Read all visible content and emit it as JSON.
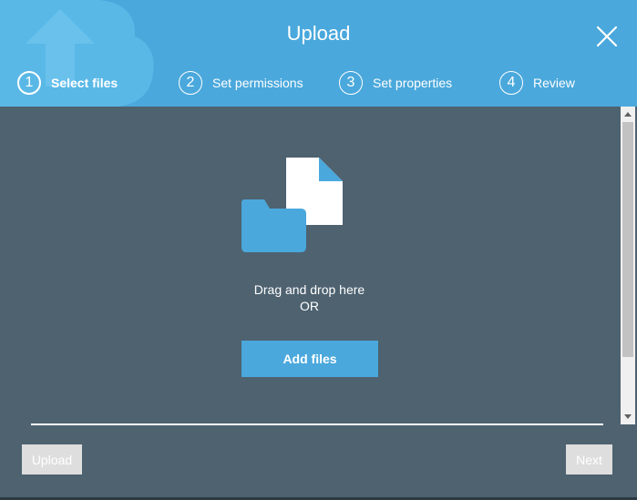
{
  "dialog": {
    "title": "Upload",
    "close_icon": "close-icon"
  },
  "steps": [
    {
      "number": "1",
      "label": "Select files",
      "active": true
    },
    {
      "number": "2",
      "label": "Set permissions",
      "active": false
    },
    {
      "number": "3",
      "label": "Set properties",
      "active": false
    },
    {
      "number": "4",
      "label": "Review",
      "active": false
    }
  ],
  "dropzone": {
    "icon": "folder-file-icon",
    "line1": "Drag and drop here",
    "line2": "OR",
    "add_files_label": "Add files"
  },
  "footer": {
    "upload_label": "Upload",
    "next_label": "Next"
  },
  "colors": {
    "header_bg": "#4aa8dc",
    "body_bg": "#4e6270",
    "disabled_button": "#dedede"
  }
}
